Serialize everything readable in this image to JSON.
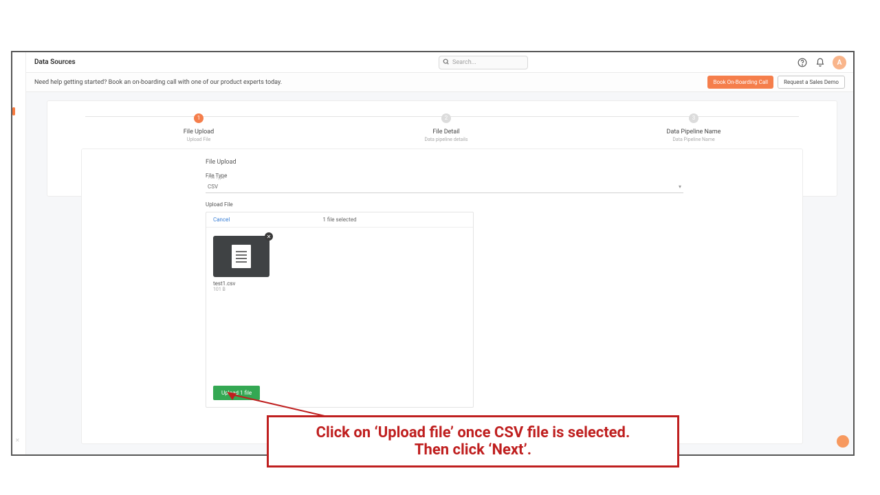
{
  "header": {
    "title": "Data Sources",
    "search_placeholder": "Search...",
    "avatar_initial": "A"
  },
  "banner": {
    "message": "Need help getting started? Book an on-boarding call with one of our product experts today.",
    "book_btn": "Book On-Boarding Call",
    "demo_btn": "Request a Sales Demo"
  },
  "stepper": {
    "steps": [
      {
        "num": "1",
        "label": "File Upload",
        "sub": "Upload File",
        "active": true
      },
      {
        "num": "2",
        "label": "File Detail",
        "sub": "Data pipeline details",
        "active": false
      },
      {
        "num": "3",
        "label": "Data Pipeline Name",
        "sub": "Data Pipeline Name",
        "active": false
      }
    ]
  },
  "form": {
    "section_title": "File Upload",
    "file_type_label": "File Type",
    "file_type_inner_label": "File Type",
    "file_type_value": "CSV",
    "upload_file_label": "Upload File",
    "cancel": "Cancel",
    "selected_count": "1 file selected",
    "file": {
      "name": "test1.csv",
      "size": "101 B"
    },
    "upload_btn": "Upload 1 file"
  },
  "callout": {
    "line1": "Click on ‘Upload file’ once CSV  file is selected.",
    "line2": "Then click ‘Next’."
  }
}
